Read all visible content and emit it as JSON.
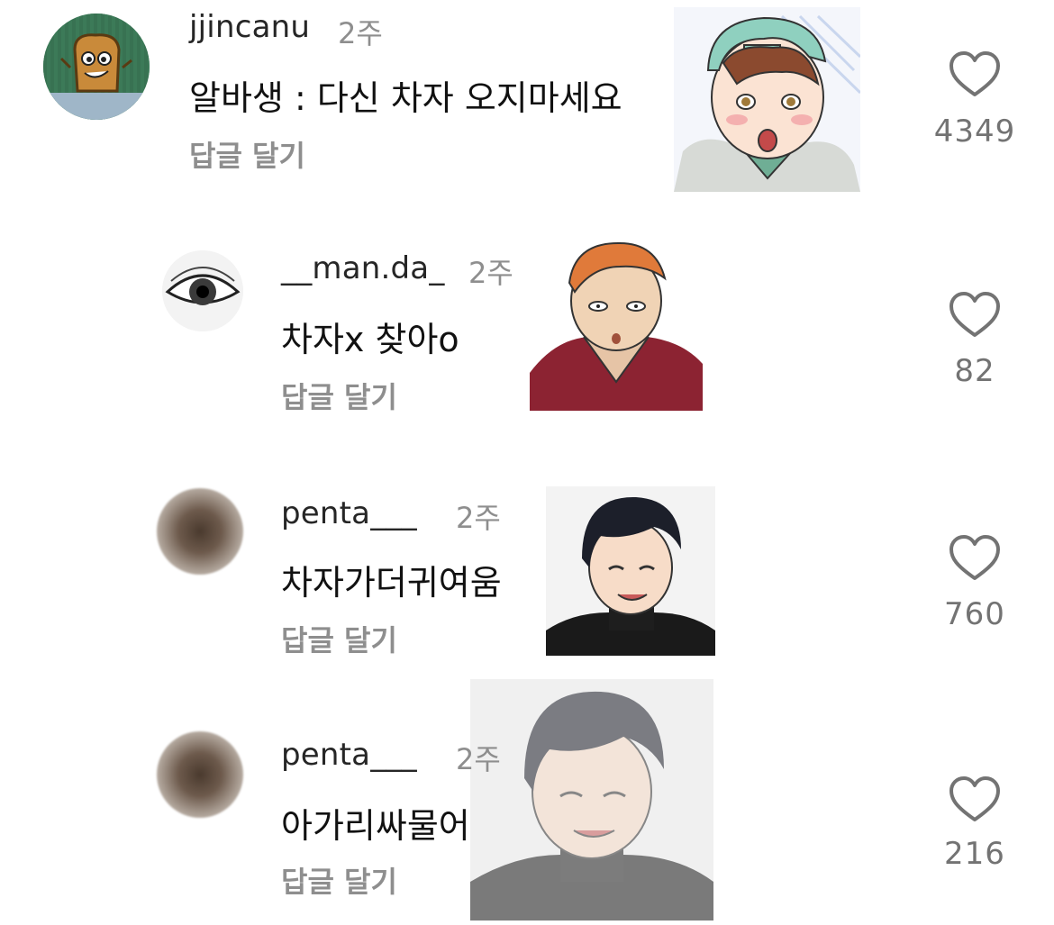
{
  "comments": [
    {
      "username": "jjincanu",
      "time": "2주",
      "text": "알바생 : 다신 차자 오지마세요",
      "reply_label": "답글 달기",
      "likes": "4349",
      "avatar": "toast-cartoon-avatar",
      "sticker": "cap-boy-sticker"
    },
    {
      "username": "__man.da_",
      "time": "2주",
      "text": "차자x 찾아o",
      "reply_label": "답글 달기",
      "likes": "82",
      "avatar": "eye-avatar",
      "sticker": "redhead-hoodie-sticker"
    },
    {
      "username": "penta___",
      "time": "2주",
      "text": "차자가더귀여움",
      "reply_label": "답글 달기",
      "likes": "760",
      "avatar": "blurred-avatar",
      "sticker": "smiling-black-hair-sticker"
    },
    {
      "username": "penta___",
      "time": "2주",
      "text": "아가리싸물어",
      "reply_label": "답글 달기",
      "likes": "216",
      "avatar": "blurred-avatar",
      "sticker": "smiling-black-hair-faded-sticker"
    }
  ],
  "colors": {
    "text": "#111111",
    "secondary": "#8e8e8e",
    "like_count": "#737373",
    "heart_stroke": "#737373"
  }
}
